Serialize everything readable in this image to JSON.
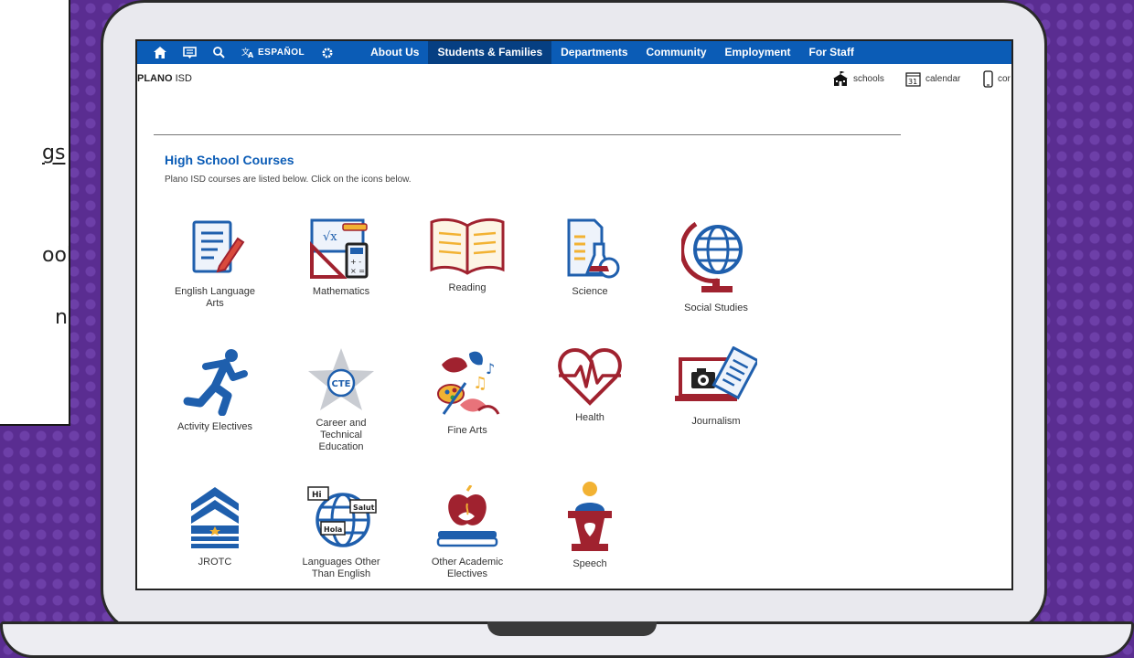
{
  "slide": {
    "fragments": [
      "gs",
      "ool",
      "n"
    ]
  },
  "nav": {
    "language_label": "ESPAÑOL",
    "items": [
      "About Us",
      "Students & Families",
      "Departments",
      "Community",
      "Employment",
      "For Staff"
    ],
    "active_index": 1
  },
  "header": {
    "district_bold": "PLANO",
    "district_rest": "ISD",
    "utility": {
      "schools": "schools",
      "calendar_day": "31",
      "calendar": "calendar",
      "contact": "cor"
    }
  },
  "main": {
    "title": "High School Courses",
    "intro": "Plano ISD courses are listed below.  Click on the icons below.",
    "courses": [
      {
        "line1": "English Language",
        "line2": "Arts",
        "line3": ""
      },
      {
        "line1": "Mathematics",
        "line2": "",
        "line3": ""
      },
      {
        "line1": "Reading",
        "line2": "",
        "line3": ""
      },
      {
        "line1": "Science",
        "line2": "",
        "line3": ""
      },
      {
        "line1": "Social Studies",
        "line2": "",
        "line3": ""
      },
      {
        "line1": "Activity Electives",
        "line2": "",
        "line3": ""
      },
      {
        "line1": "Career and",
        "line2": "Technical",
        "line3": "Education",
        "badge": "CTE"
      },
      {
        "line1": "Fine Arts",
        "line2": "",
        "line3": ""
      },
      {
        "line1": "Health",
        "line2": "",
        "line3": ""
      },
      {
        "line1": "Journalism",
        "line2": "",
        "line3": ""
      },
      {
        "line1": "JROTC",
        "line2": "",
        "line3": ""
      },
      {
        "line1": "Languages Other",
        "line2": "Than English",
        "line3": "",
        "bubbles": [
          "Hi",
          "Salut",
          "Hola"
        ]
      },
      {
        "line1": "Other Academic",
        "line2": "Electives",
        "line3": ""
      },
      {
        "line1": "Speech",
        "line2": "",
        "line3": ""
      }
    ]
  },
  "colors": {
    "nav_blue": "#0b5cb6",
    "nav_active": "#063f82",
    "icon_blue": "#1f5fad",
    "icon_red": "#a0222f",
    "background_purple": "#5a2d91"
  }
}
